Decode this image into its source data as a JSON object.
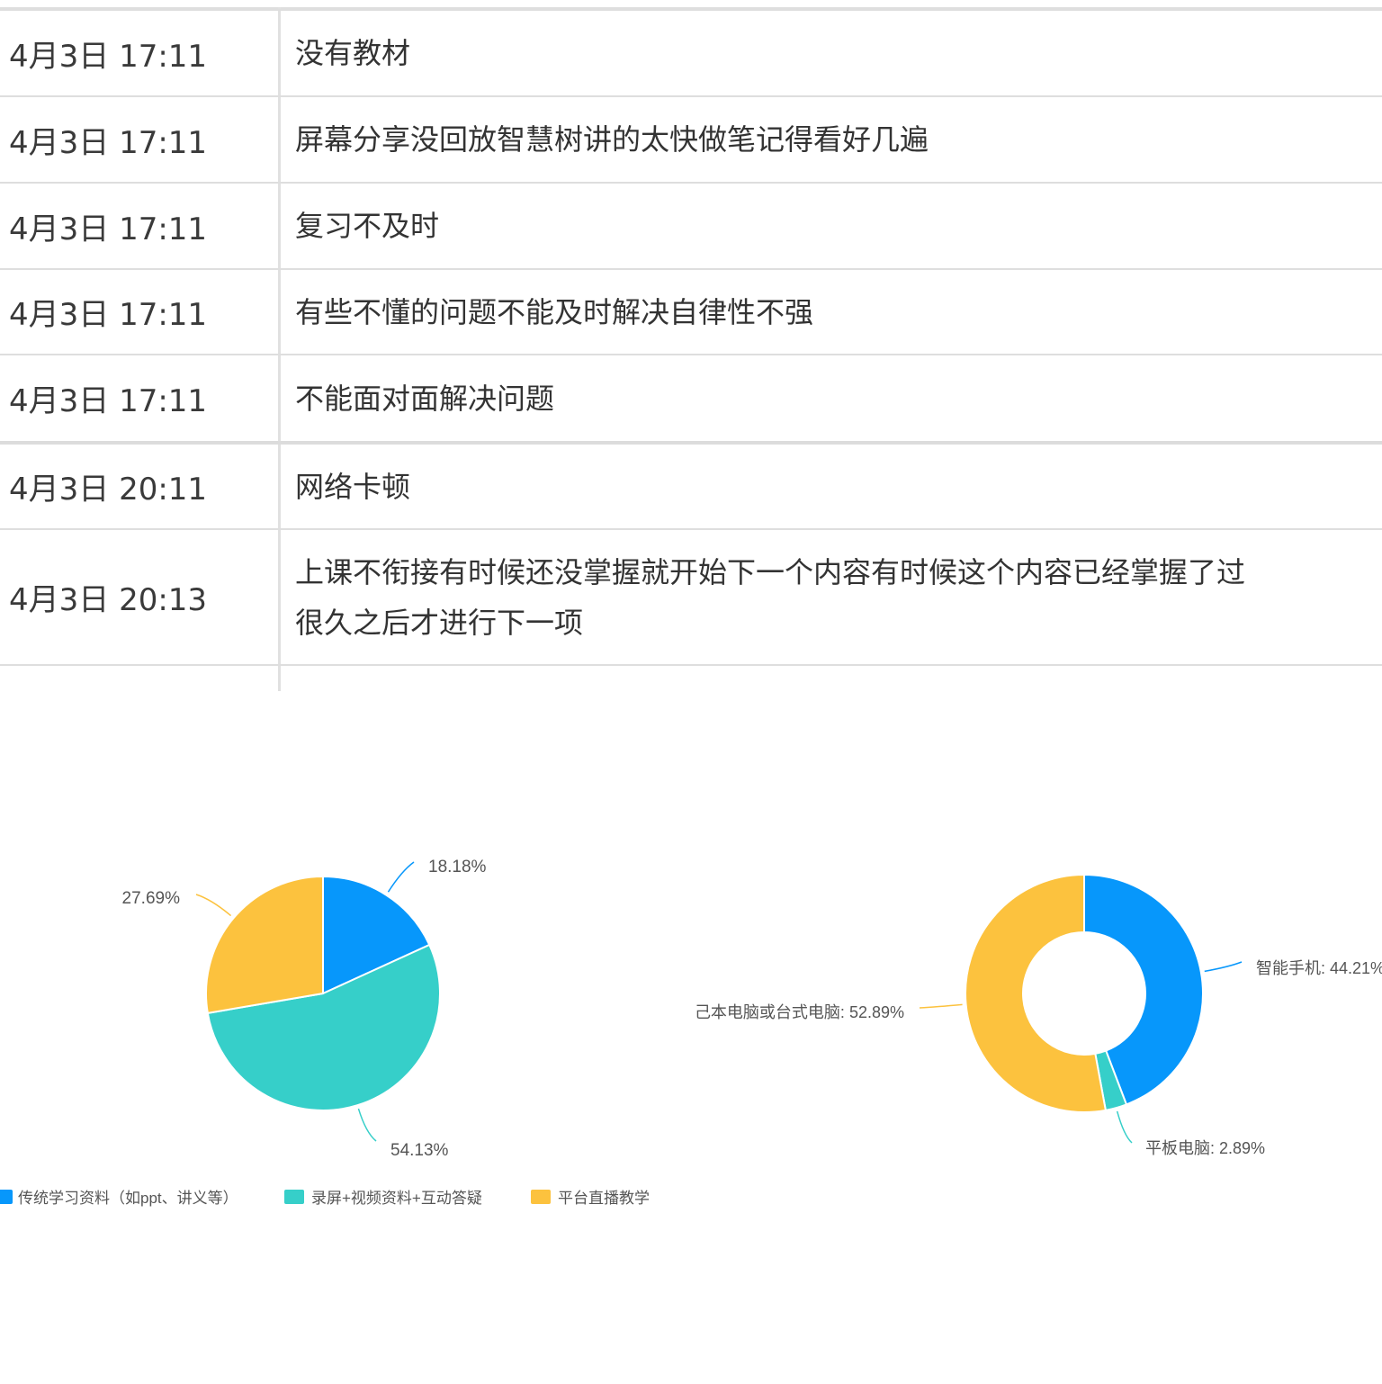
{
  "table": {
    "rows": [
      {
        "time": "4月3日 17:11",
        "text": "没有教材"
      },
      {
        "time": "4月3日 17:11",
        "text": "屏幕分享没回放智慧树讲的太快做笔记得看好几遍"
      },
      {
        "time": "4月3日 17:11",
        "text": "复习不及时"
      },
      {
        "time": "4月3日 17:11",
        "text": "有些不懂的问题不能及时解决自律性不强"
      },
      {
        "time": "4月3日 17:11",
        "text": "不能面对面解决问题"
      },
      {
        "time": "4月3日 20:11",
        "text": "网络卡顿"
      },
      {
        "time": "4月3日 20:13",
        "text": "上课不衔接有时候还没掌握就开始下一个内容有时候这个内容已经掌握了过\n很久之后才进行下一项"
      }
    ]
  },
  "chart_data": [
    {
      "type": "pie",
      "categories": [
        "传统学习资料（如ppt、讲义等）",
        "录屏+视频资料+互动答疑",
        "平台直播教学"
      ],
      "values": [
        18.18,
        54.13,
        27.69
      ],
      "labels": [
        "18.18%",
        "54.13%",
        "27.69%"
      ],
      "colors": [
        "#0797fb",
        "#36cfc9",
        "#fcc23e"
      ],
      "legend": "bottom-left"
    },
    {
      "type": "pie",
      "donut": true,
      "categories": [
        "智能手机",
        "平板电脑",
        "己本电脑或台式电脑"
      ],
      "values": [
        44.21,
        2.89,
        52.89
      ],
      "labels": [
        "智能手机: 44.21%",
        "平板电脑: 2.89%",
        "己本电脑或台式电脑: 52.89%"
      ],
      "colors": [
        "#0797fb",
        "#36cfc9",
        "#fcc23e"
      ]
    }
  ]
}
